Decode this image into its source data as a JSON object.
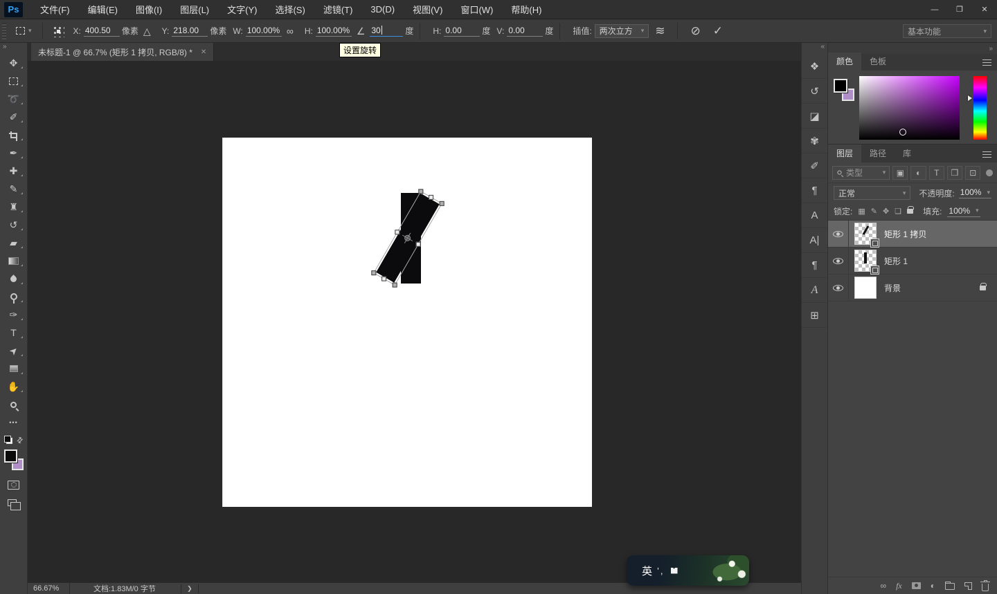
{
  "menu_bar": {
    "logo": "Ps",
    "items": [
      {
        "label": "文件(F)"
      },
      {
        "label": "编辑(E)"
      },
      {
        "label": "图像(I)"
      },
      {
        "label": "图层(L)"
      },
      {
        "label": "文字(Y)"
      },
      {
        "label": "选择(S)"
      },
      {
        "label": "滤镜(T)"
      },
      {
        "label": "3D(D)"
      },
      {
        "label": "视图(V)"
      },
      {
        "label": "窗口(W)"
      },
      {
        "label": "帮助(H)"
      }
    ],
    "window_controls": {
      "minimize": "—",
      "restore": "❐",
      "close": "✕"
    }
  },
  "options_bar": {
    "tool_preset_chevron": "▾",
    "x": {
      "label": "X:",
      "value": "400.50",
      "unit": "像素"
    },
    "delta_icon": "△",
    "y": {
      "label": "Y:",
      "value": "218.00",
      "unit": "像素"
    },
    "w": {
      "label": "W:",
      "value": "100.00%"
    },
    "link_icon": "∞",
    "h": {
      "label": "H:",
      "value": "100.00%"
    },
    "angle_icon": "∠",
    "angle": {
      "value": "30",
      "unit": "度"
    },
    "h_skew": {
      "label": "H:",
      "value": "0.00",
      "unit": "度"
    },
    "v_skew": {
      "label": "V:",
      "value": "0.00",
      "unit": "度"
    },
    "interpolation": {
      "label": "插值:",
      "value": "两次立方",
      "chevron": "▾"
    },
    "warp_icon": "≋",
    "cancel_icon": "⊘",
    "commit_icon": "✓",
    "workspace": {
      "value": "基本功能",
      "chevron": "▾"
    }
  },
  "tooltip": {
    "text": "设置旋转"
  },
  "tab_bar": {
    "document_tab": {
      "title": "未标题-1 @ 66.7% (矩形 1 拷贝, RGB/8) *",
      "close_icon": "✕"
    }
  },
  "toolbar": {
    "expand_icon": "»",
    "tools": [
      {
        "name": "move",
        "glyph": "✥"
      },
      {
        "name": "marquee",
        "glyph": ""
      },
      {
        "name": "lasso",
        "glyph": "➰"
      },
      {
        "name": "quick-selection",
        "glyph": "✐"
      },
      {
        "name": "crop",
        "glyph": ""
      },
      {
        "name": "eyedropper",
        "glyph": "✒"
      },
      {
        "name": "healing-brush",
        "glyph": "✚"
      },
      {
        "name": "brush",
        "glyph": "✎"
      },
      {
        "name": "clone-stamp",
        "glyph": "♜"
      },
      {
        "name": "history-brush",
        "glyph": "↺"
      },
      {
        "name": "eraser",
        "glyph": "▰"
      },
      {
        "name": "gradient",
        "glyph": ""
      },
      {
        "name": "blur",
        "glyph": ""
      },
      {
        "name": "dodge",
        "glyph": ""
      },
      {
        "name": "pen",
        "glyph": "✑"
      },
      {
        "name": "type",
        "glyph": "T"
      },
      {
        "name": "path-selection",
        "glyph": "➤"
      },
      {
        "name": "shape",
        "glyph": ""
      },
      {
        "name": "hand",
        "glyph": "✋"
      },
      {
        "name": "zoom",
        "glyph": ""
      },
      {
        "name": "more-tools",
        "glyph": "•••"
      }
    ],
    "swap_icon": "⇄",
    "foreground_color": "#0a0a0a",
    "background_color": "#b08fc9"
  },
  "dock": {
    "collapse_icon": "«",
    "panels": [
      {
        "name": "properties",
        "glyph": "❖"
      },
      {
        "name": "history",
        "glyph": "↺"
      },
      {
        "name": "navigator",
        "glyph": "◪"
      },
      {
        "name": "brushes",
        "glyph": "✾"
      },
      {
        "name": "brush-settings",
        "glyph": "✐"
      },
      {
        "name": "paragraph-styles",
        "glyph": "¶"
      },
      {
        "name": "character-styles",
        "glyph": "A"
      },
      {
        "name": "character",
        "glyph": "A|"
      },
      {
        "name": "paragraph",
        "glyph": "¶"
      },
      {
        "name": "glyphs",
        "glyph": "A"
      },
      {
        "name": "annotations",
        "glyph": "⊞"
      }
    ]
  },
  "panels": {
    "expand_icon": "»"
  },
  "color_panel": {
    "tabs": [
      {
        "label": "颜色"
      },
      {
        "label": "色板"
      }
    ],
    "foreground_color": "#000000",
    "background_color": "#b08fc9",
    "field_hue": "#c800ff"
  },
  "layers_panel": {
    "tabs": [
      {
        "label": "图层"
      },
      {
        "label": "路径"
      },
      {
        "label": "库"
      }
    ],
    "filter": {
      "search_label": "类型",
      "chevron": "▾",
      "buttons": [
        {
          "name": "pixel",
          "glyph": "▣"
        },
        {
          "name": "adjustment",
          "glyph": "◐"
        },
        {
          "name": "type",
          "glyph": "T"
        },
        {
          "name": "shape",
          "glyph": "❒"
        },
        {
          "name": "smart-object",
          "glyph": "⊡"
        }
      ]
    },
    "blend_mode": {
      "value": "正常",
      "chevron": "▾"
    },
    "opacity": {
      "label": "不透明度:",
      "value": "100%",
      "chevron": "▾"
    },
    "lock": {
      "label": "锁定:",
      "icons": [
        {
          "name": "lock-transparency",
          "glyph": "▦"
        },
        {
          "name": "lock-pixels",
          "glyph": "✎"
        },
        {
          "name": "lock-position",
          "glyph": "✥"
        },
        {
          "name": "lock-artboard",
          "glyph": "❏"
        }
      ]
    },
    "fill": {
      "label": "填充:",
      "value": "100%",
      "chevron": "▾"
    },
    "layers": [
      {
        "name": "矩形 1 拷贝",
        "selected": true,
        "visible": true
      },
      {
        "name": "矩形 1",
        "selected": false,
        "visible": true
      },
      {
        "name": "背景",
        "selected": false,
        "visible": true,
        "locked": true
      }
    ],
    "footer": {
      "link_glyph": "∞",
      "fx_label": "fx",
      "adjustment_glyph": "◐"
    }
  },
  "status_bar": {
    "zoom_level": "66.67%",
    "document_info": "文档:1.83M/0 字节",
    "expand_icon": "❯"
  },
  "ime": {
    "mode_label": "英",
    "marks": "’,"
  }
}
